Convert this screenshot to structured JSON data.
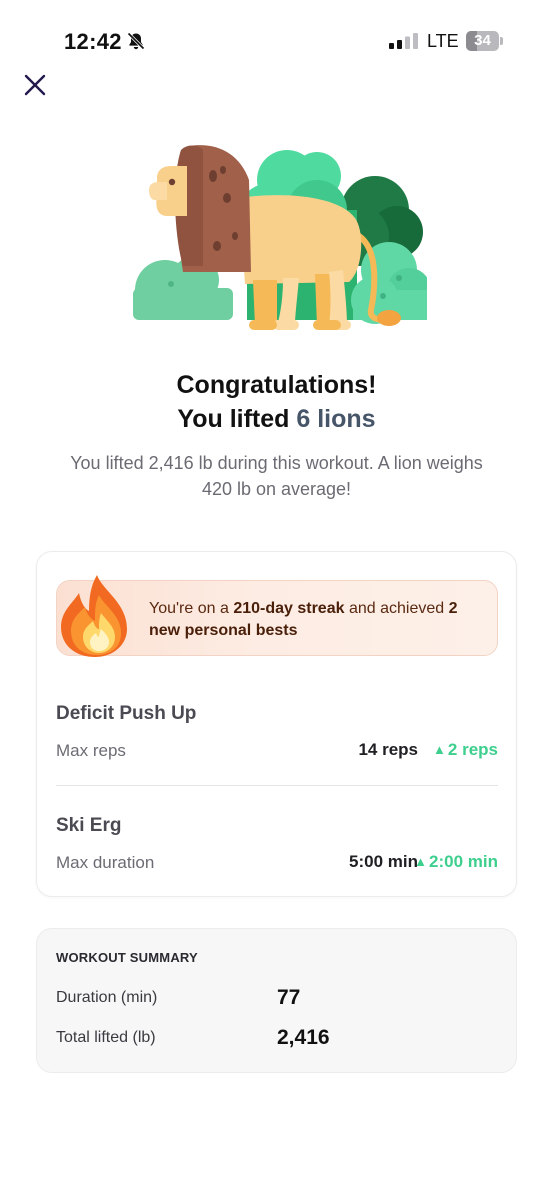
{
  "status_bar": {
    "time": "12:42",
    "network": "LTE",
    "battery_level": "34"
  },
  "icons": {
    "close": "close-icon",
    "bell_off": "bell-off-icon",
    "signal": "signal-icon",
    "battery": "battery-icon",
    "hero": "lion-illustration",
    "flame": "flame-icon",
    "delta": "triangle-up-icon"
  },
  "hero": {
    "line1": "Congratulations!",
    "line2_prefix": "You lifted ",
    "line2_accent": "6 lions",
    "subtitle": "You lifted 2,416 lb during this workout. A lion weighs 420 lb on average!"
  },
  "streak": {
    "prefix": "You're on a ",
    "streak_highlight": "210-day streak",
    "middle": " and achieved ",
    "bests_highlight": "2 new personal bests"
  },
  "records": [
    {
      "exercise": "Deficit Push Up",
      "metric": "Max reps",
      "value": "14 reps",
      "improvement": "2 reps"
    },
    {
      "exercise": "Ski Erg",
      "metric": "Max duration",
      "value": "5:00 min",
      "improvement": "2:00 min"
    }
  ],
  "summary": {
    "heading": "WORKOUT SUMMARY",
    "rows": [
      {
        "label": "Duration (min)",
        "value": "77"
      },
      {
        "label": "Total lifted (lb)",
        "value": "2,416"
      }
    ]
  },
  "colors": {
    "accent_text": "#475569",
    "improvement_green": "#3ecf8e",
    "streak_background": "#fde7dc",
    "lion_mane": "#a0604a",
    "lion_body": "#f9d08b",
    "bush_green": "#3fc187"
  },
  "battery_fraction": 0.34
}
